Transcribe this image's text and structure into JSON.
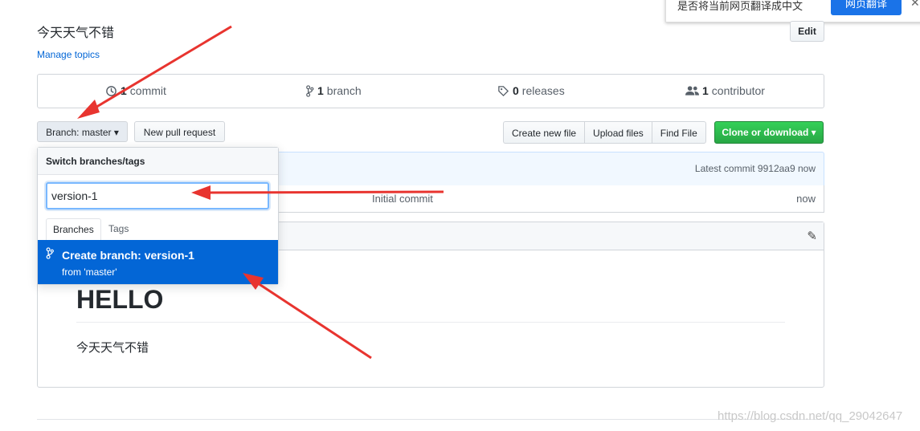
{
  "translate_bar": {
    "text": "是否将当前网页翻译成中文",
    "button": "网页翻译",
    "close": "✕"
  },
  "repo": {
    "description": "今天天气不错",
    "edit_label": "Edit",
    "manage_topics": "Manage topics"
  },
  "numbers": {
    "commits": {
      "count": "1",
      "label": "commit"
    },
    "branches": {
      "count": "1",
      "label": "branch"
    },
    "releases": {
      "count": "0",
      "label": "releases"
    },
    "contributors": {
      "count": "1",
      "label": "contributor"
    }
  },
  "toolbar": {
    "branch_label": "Branch: master ▾",
    "new_pr": "New pull request",
    "create_file": "Create new file",
    "upload_files": "Upload files",
    "find_file": "Find File",
    "clone": "Clone or download ▾"
  },
  "commit_bar": {
    "latest": "Latest commit 9912aa9 now"
  },
  "file_row": {
    "message": "Initial commit",
    "age": "now"
  },
  "readme": {
    "heading": "HELLO",
    "paragraph": "今天天气不错"
  },
  "dropdown": {
    "title": "Switch branches/tags",
    "input_value": "version-1",
    "tabs": [
      "Branches",
      "Tags"
    ],
    "create_title": "Create branch: version-1",
    "create_sub": "from 'master'"
  },
  "watermark": "https://blog.csdn.net/qq_29042647",
  "colors": {
    "accent": "#0366d6",
    "arrow": "#e8342f",
    "green": "#28a745"
  }
}
